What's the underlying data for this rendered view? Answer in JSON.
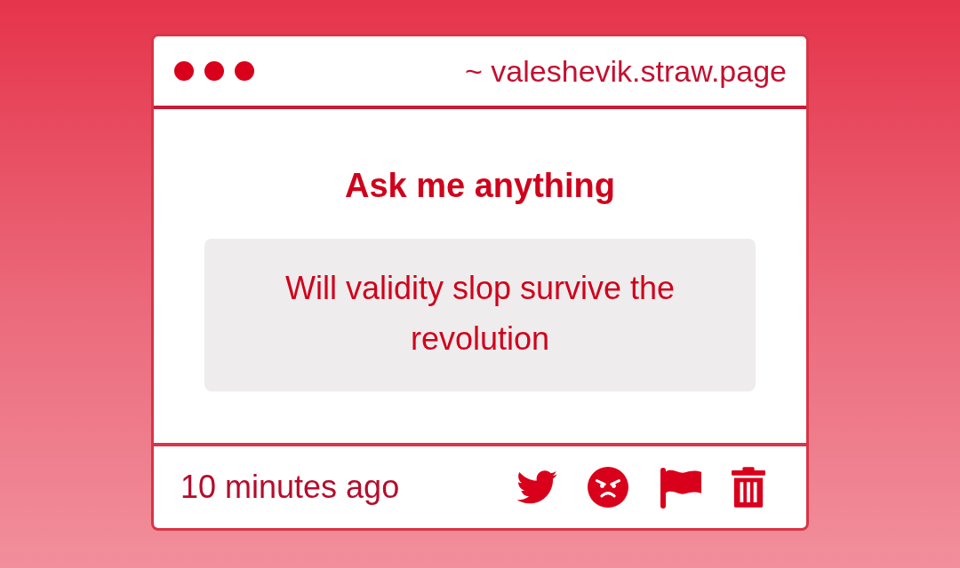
{
  "window": {
    "url": "~ valeshevik.straw.page"
  },
  "content": {
    "title": "Ask me anything",
    "question": "Will validity slop survive the revolution"
  },
  "footer": {
    "timestamp": "10 minutes ago",
    "actions": [
      {
        "kind": "twitter"
      },
      {
        "kind": "angry"
      },
      {
        "kind": "flag"
      },
      {
        "kind": "trash"
      }
    ]
  }
}
